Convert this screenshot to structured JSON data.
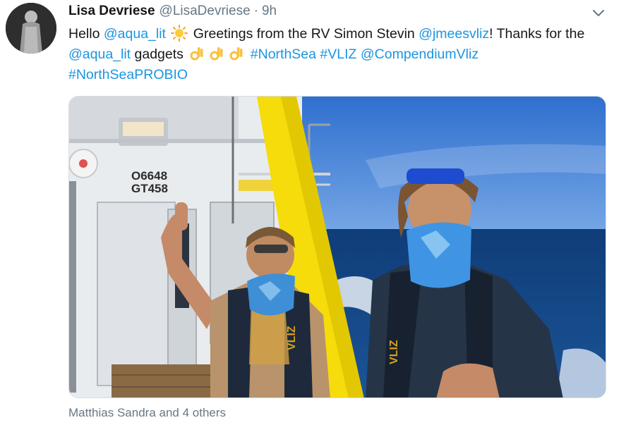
{
  "tweet": {
    "author_name": "Lisa Devriese",
    "author_handle": "@LisaDevriese",
    "separator": "·",
    "timestamp": "9h",
    "text_parts": {
      "hello": "Hello ",
      "mention_aqua_lit_1": "@aqua_lit",
      "greetings": " Greetings from the RV Simon Stevin ",
      "mention_jmeesvliz": "@jmeesvliz",
      "thanks": "! Thanks for the ",
      "mention_aqua_lit_2": "@aqua_lit",
      "gadgets": " gadgets ",
      "hashtag_northsea": "#NorthSea",
      "hashtag_vliz": "#VLIZ",
      "mention_compendium": "@CompendiumVliz",
      "hashtag_probio": "#NorthSeaPROBIO"
    },
    "emojis": [
      "sun-emoji",
      "ok-hand-emoji",
      "ok-hand-emoji",
      "ok-hand-emoji"
    ],
    "likes_summary": "Matthias Sandra and 4 others",
    "photo": {
      "hull_marking_line1": "O6648",
      "hull_marking_line2": "GT458",
      "vest_text": "VLIZ"
    }
  },
  "colors": {
    "link": "#1b95e0",
    "secondary_text": "#657786",
    "primary_text": "#14171a",
    "sky": "#3f7fd4",
    "sea": "#123f7a",
    "post_yellow": "#f5dc0a"
  }
}
